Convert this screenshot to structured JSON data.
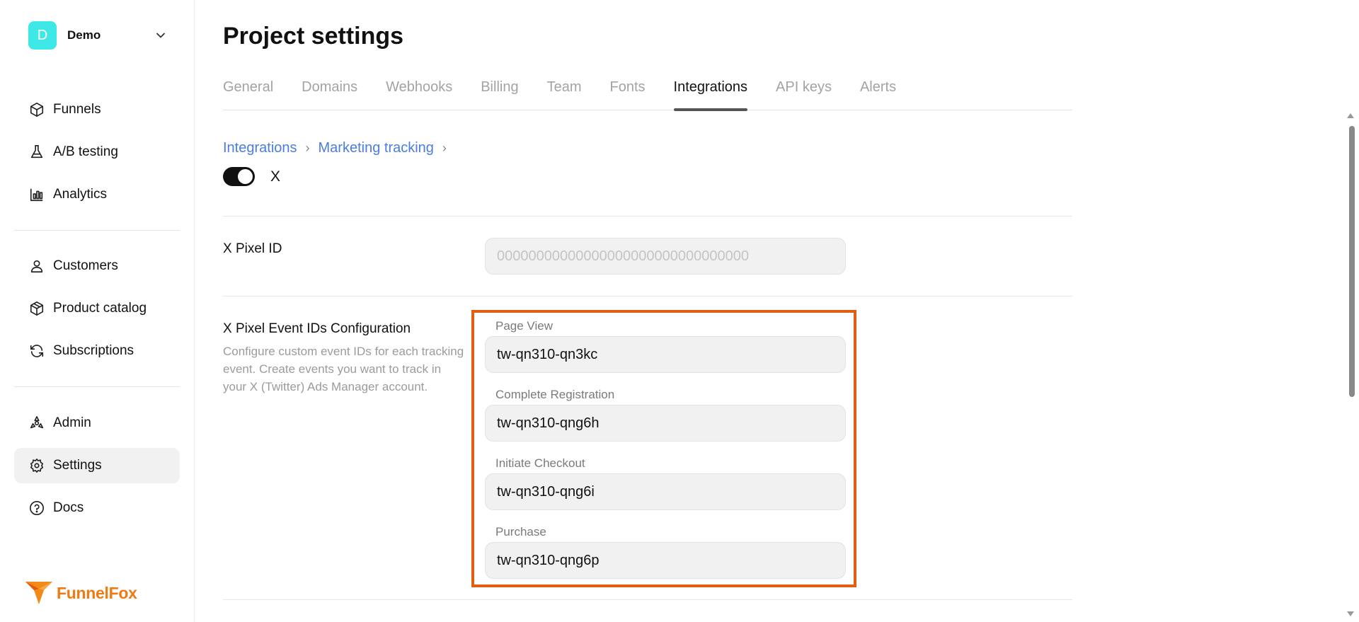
{
  "workspace": {
    "initial": "D",
    "name": "Demo"
  },
  "sidebar": {
    "items": [
      {
        "label": "Funnels",
        "icon": "box-icon"
      },
      {
        "label": "A/B testing",
        "icon": "flask-icon"
      },
      {
        "label": "Analytics",
        "icon": "bar-chart-icon"
      },
      {
        "label": "Customers",
        "icon": "user-icon"
      },
      {
        "label": "Product catalog",
        "icon": "package-icon"
      },
      {
        "label": "Subscriptions",
        "icon": "refresh-icon"
      },
      {
        "label": "Admin",
        "icon": "admin-icon"
      },
      {
        "label": "Settings",
        "icon": "gear-icon",
        "active": true
      },
      {
        "label": "Docs",
        "icon": "help-circle-icon"
      }
    ]
  },
  "brand": {
    "name": "FunnelFox",
    "color": "#f07a12"
  },
  "page": {
    "title": "Project settings"
  },
  "tabs": [
    {
      "label": "General"
    },
    {
      "label": "Domains"
    },
    {
      "label": "Webhooks"
    },
    {
      "label": "Billing"
    },
    {
      "label": "Team"
    },
    {
      "label": "Fonts"
    },
    {
      "label": "Integrations",
      "active": true
    },
    {
      "label": "API keys"
    },
    {
      "label": "Alerts"
    }
  ],
  "breadcrumb": {
    "items": [
      "Integrations",
      "Marketing tracking"
    ]
  },
  "integration": {
    "name": "X",
    "enabled": true
  },
  "pixel_id": {
    "label": "X Pixel ID",
    "placeholder": "00000000000000000000000000000000",
    "value": ""
  },
  "events": {
    "title": "X Pixel Event IDs Configuration",
    "description": "Configure custom event IDs for each tracking event. Create events you want to track in your X (Twitter) Ads Manager account.",
    "fields": [
      {
        "label": "Page View",
        "value": "tw-qn310-qn3kc"
      },
      {
        "label": "Complete Registration",
        "value": "tw-qn310-qng6h"
      },
      {
        "label": "Initiate Checkout",
        "value": "tw-qn310-qng6i"
      },
      {
        "label": "Purchase",
        "value": "tw-qn310-qng6p"
      }
    ]
  },
  "colors": {
    "accent_link": "#4a7de0",
    "highlight_border": "#e0600f",
    "avatar_bg": "#3ee8e6"
  }
}
